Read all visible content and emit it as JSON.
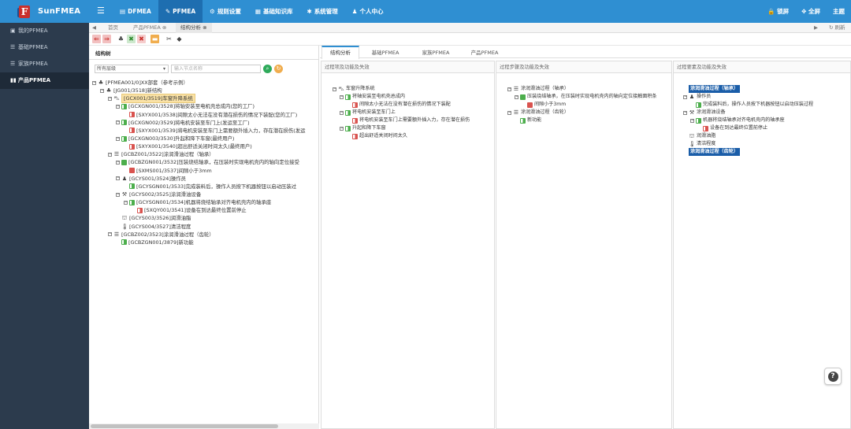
{
  "app": {
    "name": "SunFMEA",
    "logo_letter": "F"
  },
  "nav": [
    {
      "label": "DFMEA",
      "icon": "▤"
    },
    {
      "label": "PFMEA",
      "icon": "✎"
    },
    {
      "label": "规则设置",
      "icon": "⚙"
    },
    {
      "label": "基础知识库",
      "icon": "▦"
    },
    {
      "label": "系统管理",
      "icon": "✱"
    },
    {
      "label": "个人中心",
      "icon": "♟"
    }
  ],
  "topright": [
    {
      "label": "锁屏",
      "icon": "🔒"
    },
    {
      "label": "全屏",
      "icon": "✥"
    },
    {
      "label": "主题",
      "icon": ""
    }
  ],
  "sidebar": [
    {
      "label": "我的PFMEA",
      "icon": "▣"
    },
    {
      "label": "基础PFMEA",
      "icon": "☰"
    },
    {
      "label": "家族PFMEA",
      "icon": "☰"
    },
    {
      "label": "产品PFMEA",
      "icon": "▮▮"
    }
  ],
  "tabs": {
    "back": "◀",
    "home": "首页",
    "tab1": "产品PFMEA",
    "tab2": "结构分析",
    "forward": "▶",
    "refresh": "刷新",
    "refresh_icon": "↻",
    "close": "⊗"
  },
  "left": {
    "title": "结构树",
    "level_select": "所有层级",
    "search_placeholder": "输入节点名称",
    "tree": [
      {
        "d": 0,
        "tog": "⊟",
        "icon": "sys",
        "text": "[PFMEA001/0]XX部套（参考示例）"
      },
      {
        "d": 1,
        "tog": "⊟",
        "icon": "sys",
        "text": "[JG001/3518]新结构"
      },
      {
        "d": 2,
        "tog": "⊟",
        "icon": "car",
        "text": "[GCX001/3519]车窗升降系统",
        "hl": true
      },
      {
        "d": 3,
        "tog": "⊟",
        "icon": "g",
        "text": "[GCXGN001/3528]将轴安装至电机壳总成内(您的工厂)"
      },
      {
        "d": 4,
        "tog": "",
        "icon": "r",
        "text": "[SXYX001/3538]间隙太小无法在没有潜在损伤的情况下装配(您的工厂)"
      },
      {
        "d": 3,
        "tog": "⊟",
        "icon": "g",
        "text": "[GCXGN002/3529]将电机安装至车门上(发运至工厂)"
      },
      {
        "d": 4,
        "tog": "",
        "icon": "r",
        "text": "[SXYX001/3539]将电机安装至车门上需要额外插入力，存在潜在损伤(发运"
      },
      {
        "d": 3,
        "tog": "⊟",
        "icon": "g",
        "text": "[GCXGN003/3530]升起和降下车窗(最终用户)"
      },
      {
        "d": 4,
        "tog": "",
        "icon": "r",
        "text": "[SXYX001/3540]超出舒适关闭时间太久(最终用户)"
      },
      {
        "d": 2,
        "tog": "⊟",
        "icon": "list",
        "text": "[GCBZ001/3522]涂润滑油过程（轴承）"
      },
      {
        "d": 3,
        "tog": "⊟",
        "icon": "gfull",
        "text": "[GCBZGN001/3532]压装烧结轴承，在压装时实现电机壳内的轴向定位接受"
      },
      {
        "d": 4,
        "tog": "",
        "icon": "rfull",
        "text": "[SXMS001/3537]间隙小于3mm"
      },
      {
        "d": 3,
        "tog": "⊟",
        "icon": "person",
        "text": "[GCYS001/3524]操作员"
      },
      {
        "d": 4,
        "tog": "",
        "icon": "g",
        "text": "[GCYSGN001/3533]完成装料后，操作人员按下机器按钮以启动压装过"
      },
      {
        "d": 3,
        "tog": "⊟",
        "icon": "machine",
        "text": "[GCYS002/3525]涂润滑油设备"
      },
      {
        "d": 4,
        "tog": "⊟",
        "icon": "g",
        "text": "[GCYSGN001/3534]机器将烧结轴承对齐电机壳内的轴承座"
      },
      {
        "d": 5,
        "tog": "",
        "icon": "r",
        "text": "[SXQY001/3541]设备在到达最终位置前停止"
      },
      {
        "d": 3,
        "tog": "",
        "icon": "env",
        "text": "[GCYS003/3526]润滑油脂"
      },
      {
        "d": 3,
        "tog": "",
        "icon": "temp",
        "text": "[GCYS004/3527]清洁程度"
      },
      {
        "d": 2,
        "tog": "⊟",
        "icon": "list",
        "text": "[GCBZ002/3523]涂润滑油过程（齿轮）"
      },
      {
        "d": 3,
        "tog": "",
        "icon": "g",
        "text": "[GCBZGN001/3879]新功能"
      }
    ]
  },
  "right": {
    "tabs": [
      "结构分析",
      "基础PFMEA",
      "家族PFMEA",
      "产品PFMEA"
    ],
    "col1": {
      "header": "过程项及功能及失效",
      "tree": [
        {
          "d": 0,
          "tog": "⊟",
          "icon": "car",
          "text": "车窗升降系统"
        },
        {
          "d": 1,
          "tog": "⊟",
          "icon": "g",
          "text": "将轴安装至电机壳总成内"
        },
        {
          "d": 2,
          "tog": "",
          "icon": "r",
          "text": "间隙太小无法在没有潜在损伤的情况下装配"
        },
        {
          "d": 1,
          "tog": "⊟",
          "icon": "g",
          "text": "将电机安装至车门上"
        },
        {
          "d": 2,
          "tog": "",
          "icon": "r",
          "text": "将电机安装至车门上需要额外插入力，存在潜在损伤"
        },
        {
          "d": 1,
          "tog": "⊟",
          "icon": "g",
          "text": "升起和降下车窗"
        },
        {
          "d": 2,
          "tog": "",
          "icon": "r",
          "text": "超出舒适关闭时间太久"
        }
      ]
    },
    "col2": {
      "header": "过程步骤及功能及失效",
      "tree": [
        {
          "d": 0,
          "tog": "⊟",
          "icon": "list",
          "text": "涂润滑油过程（轴承）"
        },
        {
          "d": 1,
          "tog": "⊟",
          "icon": "gfull",
          "text": "压装烧结轴承，在压装时实现电机壳内的轴向定位接触面积条"
        },
        {
          "d": 2,
          "tog": "",
          "icon": "rfull",
          "text": "间隙小于3mm"
        },
        {
          "d": 0,
          "tog": "⊟",
          "icon": "list",
          "text": "涂润滑油过程（齿轮）"
        },
        {
          "d": 1,
          "tog": "",
          "icon": "g",
          "text": "新功能"
        }
      ]
    },
    "col3": {
      "header": "过程要素及功能及失效",
      "tree": [
        {
          "d": 0,
          "tog": "",
          "icon": "none",
          "text": "涂润滑油过程（轴承）",
          "hlblue": true
        },
        {
          "d": 0,
          "tog": "⊟",
          "icon": "person",
          "text": "操作员"
        },
        {
          "d": 1,
          "tog": "",
          "icon": "g",
          "text": "完成装料后，操作人员按下机器按钮以启动压装过程"
        },
        {
          "d": 0,
          "tog": "⊟",
          "icon": "machine",
          "text": "涂润滑油设备"
        },
        {
          "d": 1,
          "tog": "⊟",
          "icon": "g",
          "text": "机器将烧结轴承对齐电机壳内的轴承座"
        },
        {
          "d": 2,
          "tog": "",
          "icon": "r",
          "text": "设备在到达最终位置前停止"
        },
        {
          "d": 0,
          "tog": "",
          "icon": "env",
          "text": "润滑油脂"
        },
        {
          "d": 0,
          "tog": "",
          "icon": "temp",
          "text": "清洁程度"
        },
        {
          "d": 0,
          "tog": "",
          "icon": "none",
          "text": "涂润滑油过程（齿轮）",
          "hlblue": true
        }
      ]
    }
  },
  "help_label": "?"
}
